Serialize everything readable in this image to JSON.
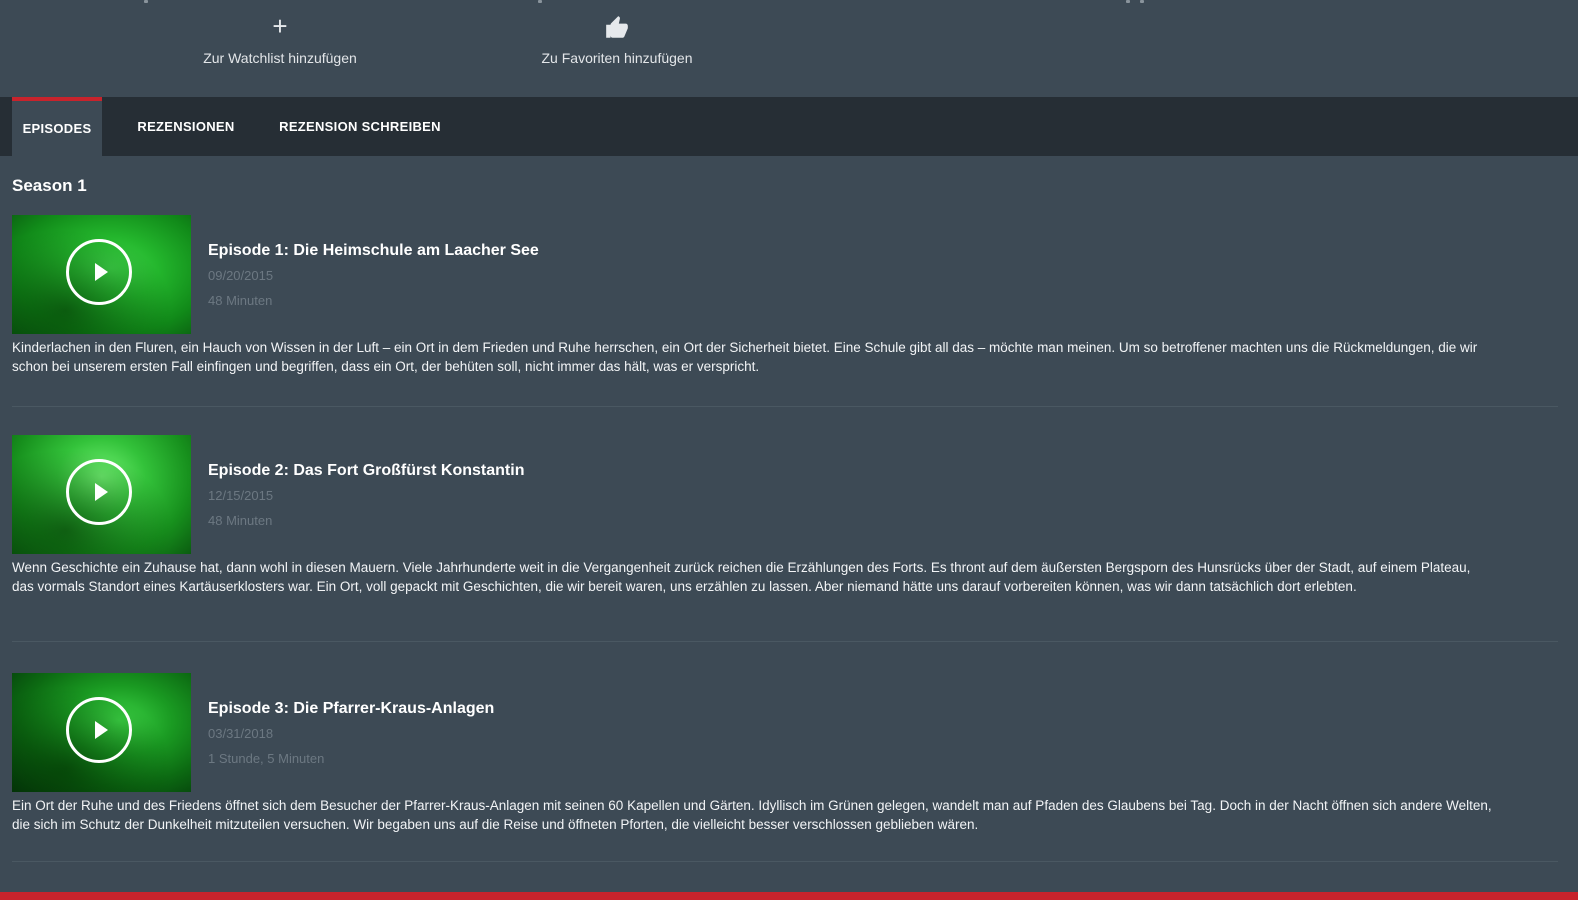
{
  "actions": {
    "watchlist": {
      "icon": "+",
      "icon_name": "plus-icon",
      "label": "Zur Watchlist hinzufügen"
    },
    "favorites": {
      "icon": "👍",
      "icon_name": "thumbs-up-icon",
      "label": "Zu Favoriten hinzufügen"
    }
  },
  "tabs": [
    {
      "label": "EPISODES",
      "active": true
    },
    {
      "label": "REZENSIONEN",
      "active": false
    },
    {
      "label": "REZENSION SCHREIBEN",
      "active": false
    }
  ],
  "season": {
    "title": "Season 1"
  },
  "episodes": [
    {
      "title": "Episode 1: Die Heimschule am Laacher See",
      "date": "09/20/2015",
      "duration": "48 Minuten",
      "description": "Kinderlachen in den Fluren, ein Hauch von Wissen in der Luft – ein Ort in dem Frieden und Ruhe herrschen, ein Ort der Sicherheit bietet. Eine Schule gibt all das – möchte man meinen. Um so betroffener machten uns die Rückmeldungen, die wir schon bei unserem ersten Fall einfingen und begriffen, dass ein Ort, der behüten soll, nicht immer das hält, was er verspricht."
    },
    {
      "title": "Episode 2: Das Fort Großfürst Konstantin",
      "date": "12/15/2015",
      "duration": "48 Minuten",
      "description": "Wenn Geschichte ein Zuhause hat, dann wohl in diesen Mauern. Viele Jahrhunderte weit in die Vergangenheit zurück reichen die Erzählungen des Forts. Es thront auf dem äußersten Bergsporn des Hunsrücks über der Stadt, auf einem Plateau, das vormals Standort eines Kartäuserklosters war. Ein Ort, voll gepackt mit Geschichten, die wir bereit waren, uns erzählen zu lassen. Aber niemand hätte uns darauf vorbereiten können, was wir dann tatsächlich dort erlebten."
    },
    {
      "title": "Episode 3: Die Pfarrer-Kraus-Anlagen",
      "date": "03/31/2018",
      "duration": "1 Stunde, 5 Minuten",
      "description": "Ein Ort der Ruhe und des Friedens öffnet sich dem Besucher der Pfarrer-Kraus-Anlagen mit seinen 60 Kapellen und Gärten. Idyllisch im Grünen gelegen, wandelt man auf Pfaden des Glaubens bei Tag. Doch in der Nacht öffnen sich andere Welten, die sich im Schutz der Dunkelheit mitzuteilen versuchen. Wir begaben uns auf die Reise und öffneten Pforten, die vielleicht besser verschlossen geblieben wären."
    }
  ],
  "colors": {
    "background": "#3d4a55",
    "tabbar": "#262e35",
    "accent": "#c8232c",
    "thumbnail_green": "#23b52c"
  }
}
